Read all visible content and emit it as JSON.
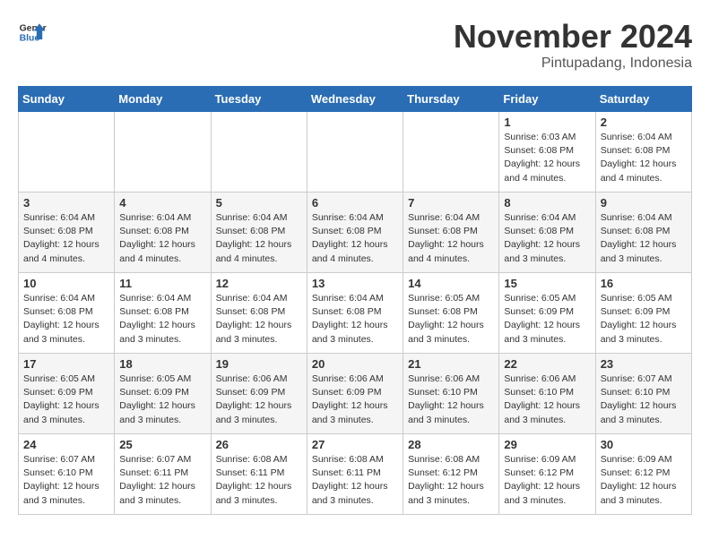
{
  "header": {
    "logo_line1": "General",
    "logo_line2": "Blue",
    "month_title": "November 2024",
    "subtitle": "Pintupadang, Indonesia"
  },
  "weekdays": [
    "Sunday",
    "Monday",
    "Tuesday",
    "Wednesday",
    "Thursday",
    "Friday",
    "Saturday"
  ],
  "weeks": [
    [
      {
        "day": "",
        "detail": ""
      },
      {
        "day": "",
        "detail": ""
      },
      {
        "day": "",
        "detail": ""
      },
      {
        "day": "",
        "detail": ""
      },
      {
        "day": "",
        "detail": ""
      },
      {
        "day": "1",
        "detail": "Sunrise: 6:03 AM\nSunset: 6:08 PM\nDaylight: 12 hours\nand 4 minutes."
      },
      {
        "day": "2",
        "detail": "Sunrise: 6:04 AM\nSunset: 6:08 PM\nDaylight: 12 hours\nand 4 minutes."
      }
    ],
    [
      {
        "day": "3",
        "detail": "Sunrise: 6:04 AM\nSunset: 6:08 PM\nDaylight: 12 hours\nand 4 minutes."
      },
      {
        "day": "4",
        "detail": "Sunrise: 6:04 AM\nSunset: 6:08 PM\nDaylight: 12 hours\nand 4 minutes."
      },
      {
        "day": "5",
        "detail": "Sunrise: 6:04 AM\nSunset: 6:08 PM\nDaylight: 12 hours\nand 4 minutes."
      },
      {
        "day": "6",
        "detail": "Sunrise: 6:04 AM\nSunset: 6:08 PM\nDaylight: 12 hours\nand 4 minutes."
      },
      {
        "day": "7",
        "detail": "Sunrise: 6:04 AM\nSunset: 6:08 PM\nDaylight: 12 hours\nand 4 minutes."
      },
      {
        "day": "8",
        "detail": "Sunrise: 6:04 AM\nSunset: 6:08 PM\nDaylight: 12 hours\nand 3 minutes."
      },
      {
        "day": "9",
        "detail": "Sunrise: 6:04 AM\nSunset: 6:08 PM\nDaylight: 12 hours\nand 3 minutes."
      }
    ],
    [
      {
        "day": "10",
        "detail": "Sunrise: 6:04 AM\nSunset: 6:08 PM\nDaylight: 12 hours\nand 3 minutes."
      },
      {
        "day": "11",
        "detail": "Sunrise: 6:04 AM\nSunset: 6:08 PM\nDaylight: 12 hours\nand 3 minutes."
      },
      {
        "day": "12",
        "detail": "Sunrise: 6:04 AM\nSunset: 6:08 PM\nDaylight: 12 hours\nand 3 minutes."
      },
      {
        "day": "13",
        "detail": "Sunrise: 6:04 AM\nSunset: 6:08 PM\nDaylight: 12 hours\nand 3 minutes."
      },
      {
        "day": "14",
        "detail": "Sunrise: 6:05 AM\nSunset: 6:08 PM\nDaylight: 12 hours\nand 3 minutes."
      },
      {
        "day": "15",
        "detail": "Sunrise: 6:05 AM\nSunset: 6:09 PM\nDaylight: 12 hours\nand 3 minutes."
      },
      {
        "day": "16",
        "detail": "Sunrise: 6:05 AM\nSunset: 6:09 PM\nDaylight: 12 hours\nand 3 minutes."
      }
    ],
    [
      {
        "day": "17",
        "detail": "Sunrise: 6:05 AM\nSunset: 6:09 PM\nDaylight: 12 hours\nand 3 minutes."
      },
      {
        "day": "18",
        "detail": "Sunrise: 6:05 AM\nSunset: 6:09 PM\nDaylight: 12 hours\nand 3 minutes."
      },
      {
        "day": "19",
        "detail": "Sunrise: 6:06 AM\nSunset: 6:09 PM\nDaylight: 12 hours\nand 3 minutes."
      },
      {
        "day": "20",
        "detail": "Sunrise: 6:06 AM\nSunset: 6:09 PM\nDaylight: 12 hours\nand 3 minutes."
      },
      {
        "day": "21",
        "detail": "Sunrise: 6:06 AM\nSunset: 6:10 PM\nDaylight: 12 hours\nand 3 minutes."
      },
      {
        "day": "22",
        "detail": "Sunrise: 6:06 AM\nSunset: 6:10 PM\nDaylight: 12 hours\nand 3 minutes."
      },
      {
        "day": "23",
        "detail": "Sunrise: 6:07 AM\nSunset: 6:10 PM\nDaylight: 12 hours\nand 3 minutes."
      }
    ],
    [
      {
        "day": "24",
        "detail": "Sunrise: 6:07 AM\nSunset: 6:10 PM\nDaylight: 12 hours\nand 3 minutes."
      },
      {
        "day": "25",
        "detail": "Sunrise: 6:07 AM\nSunset: 6:11 PM\nDaylight: 12 hours\nand 3 minutes."
      },
      {
        "day": "26",
        "detail": "Sunrise: 6:08 AM\nSunset: 6:11 PM\nDaylight: 12 hours\nand 3 minutes."
      },
      {
        "day": "27",
        "detail": "Sunrise: 6:08 AM\nSunset: 6:11 PM\nDaylight: 12 hours\nand 3 minutes."
      },
      {
        "day": "28",
        "detail": "Sunrise: 6:08 AM\nSunset: 6:12 PM\nDaylight: 12 hours\nand 3 minutes."
      },
      {
        "day": "29",
        "detail": "Sunrise: 6:09 AM\nSunset: 6:12 PM\nDaylight: 12 hours\nand 3 minutes."
      },
      {
        "day": "30",
        "detail": "Sunrise: 6:09 AM\nSunset: 6:12 PM\nDaylight: 12 hours\nand 3 minutes."
      }
    ]
  ]
}
